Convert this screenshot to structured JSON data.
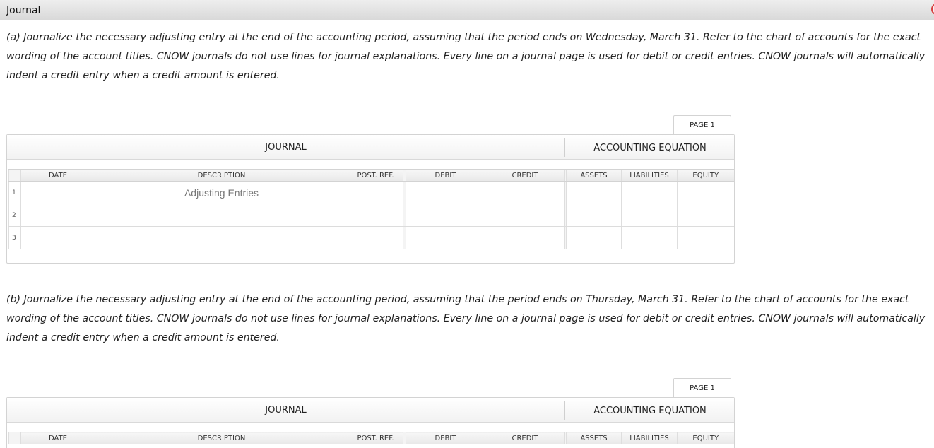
{
  "window": {
    "title": "Journal"
  },
  "parts": [
    {
      "instructions": "(a) Journalize the necessary adjusting entry at the end of the accounting period, assuming that the period ends on Wednesday, March 31. Refer to the chart of accounts for the exact wording of the account titles. CNOW journals do not use lines for journal explanations. Every line on a journal page is used for debit or credit entries. CNOW journals will automatically indent a credit entry when a credit amount is entered.",
      "page_label": "PAGE 1",
      "journal_title": "JOURNAL",
      "equation_title": "ACCOUNTING EQUATION",
      "columns": [
        "DATE",
        "DESCRIPTION",
        "POST. REF.",
        "DEBIT",
        "CREDIT",
        "ASSETS",
        "LIABILITIES",
        "EQUITY"
      ],
      "rows": [
        {
          "num": "1",
          "date": "",
          "description": "Adjusting Entries",
          "post_ref": "",
          "debit": "",
          "credit": "",
          "assets": "",
          "liabilities": "",
          "equity": ""
        },
        {
          "num": "2",
          "date": "",
          "description": "",
          "post_ref": "",
          "debit": "",
          "credit": "",
          "assets": "",
          "liabilities": "",
          "equity": ""
        },
        {
          "num": "3",
          "date": "",
          "description": "",
          "post_ref": "",
          "debit": "",
          "credit": "",
          "assets": "",
          "liabilities": "",
          "equity": ""
        }
      ]
    },
    {
      "instructions": "(b) Journalize the necessary adjusting entry at the end of the accounting period, assuming that the period ends on Thursday, March 31. Refer to the chart of accounts for the exact wording of the account titles. CNOW journals do not use lines for journal explanations. Every line on a journal page is used for debit or credit entries. CNOW journals will automatically indent a credit entry when a credit amount is entered.",
      "page_label": "PAGE 1",
      "journal_title": "JOURNAL",
      "equation_title": "ACCOUNTING EQUATION",
      "columns": [
        "DATE",
        "DESCRIPTION",
        "POST. REF.",
        "DEBIT",
        "CREDIT",
        "ASSETS",
        "LIABILITIES",
        "EQUITY"
      ]
    }
  ]
}
